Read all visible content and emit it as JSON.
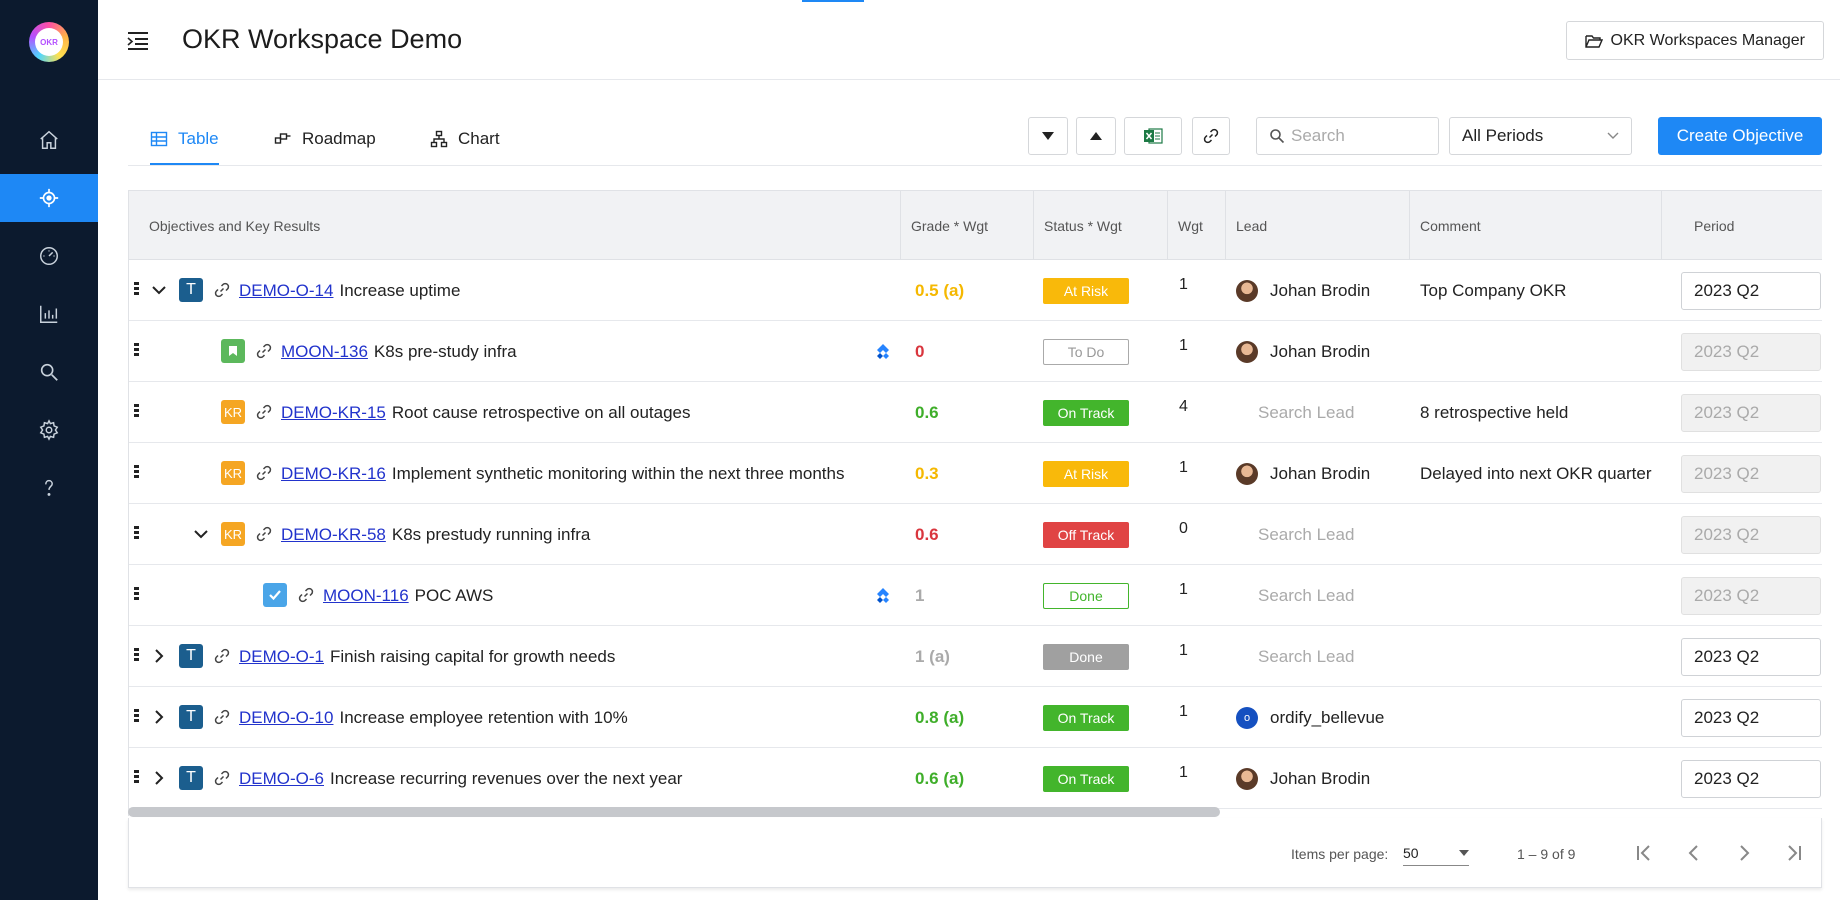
{
  "app": {
    "title": "OKR Workspace Demo",
    "logo_text": "OKR",
    "workspaces_button": "OKR Workspaces Manager",
    "accent_color": "#1e88f5"
  },
  "sidebar": {
    "items": [
      {
        "name": "home",
        "icon": "home-icon"
      },
      {
        "name": "objectives",
        "icon": "target-icon",
        "active": true
      },
      {
        "name": "dashboard",
        "icon": "gauge-icon"
      },
      {
        "name": "reports",
        "icon": "bar-chart-icon"
      },
      {
        "name": "search",
        "icon": "search-icon"
      },
      {
        "name": "settings",
        "icon": "gear-icon"
      },
      {
        "name": "help",
        "icon": "question-icon"
      }
    ]
  },
  "tabs": [
    {
      "label": "Table",
      "icon": "table-icon",
      "active": true
    },
    {
      "label": "Roadmap",
      "icon": "roadmap-icon",
      "active": false
    },
    {
      "label": "Chart",
      "icon": "hierarchy-icon",
      "active": false
    }
  ],
  "toolbar": {
    "search_placeholder": "Search",
    "period_value": "All Periods",
    "create_label": "Create Objective"
  },
  "table": {
    "columns": [
      "Objectives and Key Results",
      "Grade * Wgt",
      "Status * Wgt",
      "Wgt",
      "Lead",
      "Comment",
      "Period"
    ],
    "rows": [
      {
        "depth": 0,
        "expander": "down",
        "type": "T",
        "key": "DEMO-O-14",
        "title": "Increase uptime",
        "jira": false,
        "grade": "0.5 (a)",
        "grade_color": "#f5b800",
        "status": "At Risk",
        "status_style": "at-risk",
        "wgt": "1",
        "lead": "Johan Brodin",
        "lead_avatar": "photo",
        "comment": "Top Company OKR",
        "period": "2023 Q2",
        "period_disabled": false
      },
      {
        "depth": 1,
        "expander": "",
        "type": "story",
        "key": "MOON-136",
        "title": "K8s pre-study infra",
        "jira": true,
        "grade": "0",
        "grade_color": "#d9363e",
        "status": "To Do",
        "status_style": "todo",
        "wgt": "1",
        "lead": "Johan Brodin",
        "lead_avatar": "photo",
        "comment": "",
        "period": "2023 Q2",
        "period_disabled": true
      },
      {
        "depth": 1,
        "expander": "",
        "type": "KR",
        "key": "DEMO-KR-15",
        "title": "Root cause retrospective on all outages",
        "jira": false,
        "grade": "0.6",
        "grade_color": "#3fae2a",
        "status": "On Track",
        "status_style": "on-track",
        "wgt": "4",
        "lead": "Search Lead",
        "lead_avatar": "none",
        "comment": "8  retrospective held",
        "period": "2023 Q2",
        "period_disabled": true
      },
      {
        "depth": 1,
        "expander": "",
        "type": "KR",
        "key": "DEMO-KR-16",
        "title": "Implement synthetic monitoring within the next three months",
        "jira": false,
        "grade": "0.3",
        "grade_color": "#f5b800",
        "status": "At Risk",
        "status_style": "at-risk",
        "wgt": "1",
        "lead": "Johan Brodin",
        "lead_avatar": "photo",
        "comment": "Delayed into next OKR quarter",
        "period": "2023 Q2",
        "period_disabled": true
      },
      {
        "depth": 1,
        "expander": "down",
        "type": "KR",
        "key": "DEMO-KR-58",
        "title": "K8s prestudy running infra",
        "jira": false,
        "grade": "0.6",
        "grade_color": "#d9363e",
        "status": "Off Track",
        "status_style": "off-track",
        "wgt": "0",
        "lead": "Search Lead",
        "lead_avatar": "none",
        "comment": "",
        "period": "2023 Q2",
        "period_disabled": true
      },
      {
        "depth": 2,
        "expander": "",
        "type": "task",
        "key": "MOON-116",
        "title": "POC AWS",
        "jira": true,
        "grade": "1",
        "grade_color": "#aaaaaa",
        "status": "Done",
        "status_style": "done-outline",
        "wgt": "1",
        "lead": "Search Lead",
        "lead_avatar": "none",
        "comment": "",
        "period": "2023 Q2",
        "period_disabled": true
      },
      {
        "depth": 0,
        "expander": "right",
        "type": "T",
        "key": "DEMO-O-1",
        "title": "Finish raising capital for growth needs",
        "jira": false,
        "grade": "1 (a)",
        "grade_color": "#aaaaaa",
        "status": "Done",
        "status_style": "done-grey",
        "wgt": "1",
        "lead": "Search Lead",
        "lead_avatar": "none",
        "comment": "",
        "period": "2023 Q2",
        "period_disabled": false
      },
      {
        "depth": 0,
        "expander": "right",
        "type": "T",
        "key": "DEMO-O-10",
        "title": "Increase employee retention with 10%",
        "jira": false,
        "grade": "0.8 (a)",
        "grade_color": "#3fae2a",
        "status": "On Track",
        "status_style": "on-track",
        "wgt": "1",
        "lead": "ordify_bellevue",
        "lead_avatar": "o",
        "comment": "",
        "period": "2023 Q2",
        "period_disabled": false
      },
      {
        "depth": 0,
        "expander": "right",
        "type": "T",
        "key": "DEMO-O-6",
        "title": "Increase recurring revenues over the next year",
        "jira": false,
        "grade": "0.6 (a)",
        "grade_color": "#3fae2a",
        "status": "On Track",
        "status_style": "on-track",
        "wgt": "1",
        "lead": "Johan Brodin",
        "lead_avatar": "photo",
        "comment": "",
        "period": "2023 Q2",
        "period_disabled": false
      }
    ]
  },
  "pager": {
    "items_per_page_label": "Items per page:",
    "items_per_page_value": "50",
    "range": "1 – 9 of 9"
  }
}
